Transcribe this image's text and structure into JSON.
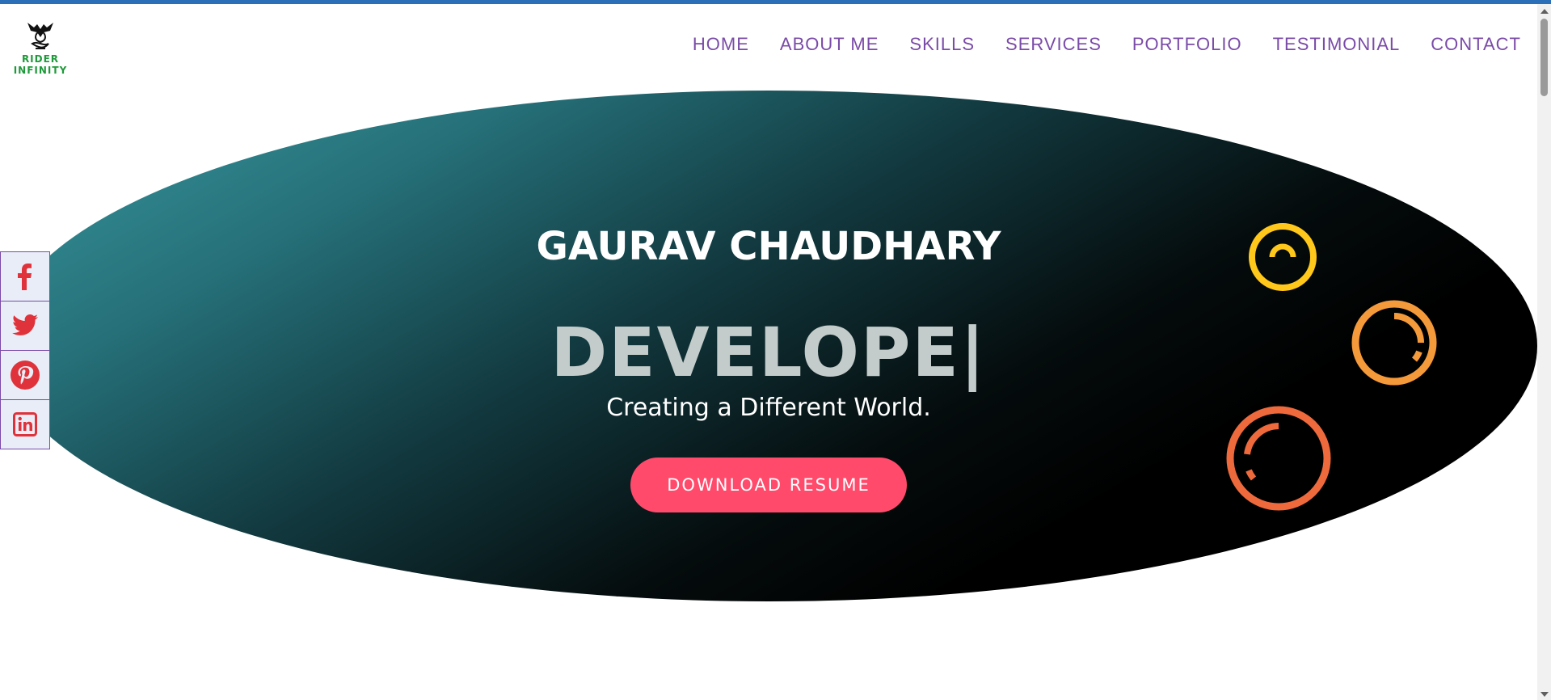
{
  "header": {
    "logo": {
      "line1": "RIDER",
      "line2": "INFINITY",
      "icon": "rider-infinity-logo"
    },
    "nav": [
      {
        "label": "HOME"
      },
      {
        "label": "ABOUT ME"
      },
      {
        "label": "SKILLS"
      },
      {
        "label": "SERVICES"
      },
      {
        "label": "PORTFOLIO"
      },
      {
        "label": "TESTIMONIAL"
      },
      {
        "label": "CONTACT"
      }
    ]
  },
  "hero": {
    "name": "GAURAV CHAUDHARY",
    "role_typed": "DEVELOPE|",
    "tagline": "Creating a Different World.",
    "button_label": "DOWNLOAD RESUME"
  },
  "social": [
    {
      "icon": "facebook-icon"
    },
    {
      "icon": "twitter-icon"
    },
    {
      "icon": "pinterest-icon"
    },
    {
      "icon": "linkedin-icon"
    }
  ],
  "colors": {
    "accent_nav": "#7a4ba8",
    "button": "#ff4a6b",
    "social_icon": "#e0323a",
    "ring_yellow": "#ffc81a",
    "ring_orange": "#f59a3a",
    "ring_coral": "#ee6a3c"
  }
}
